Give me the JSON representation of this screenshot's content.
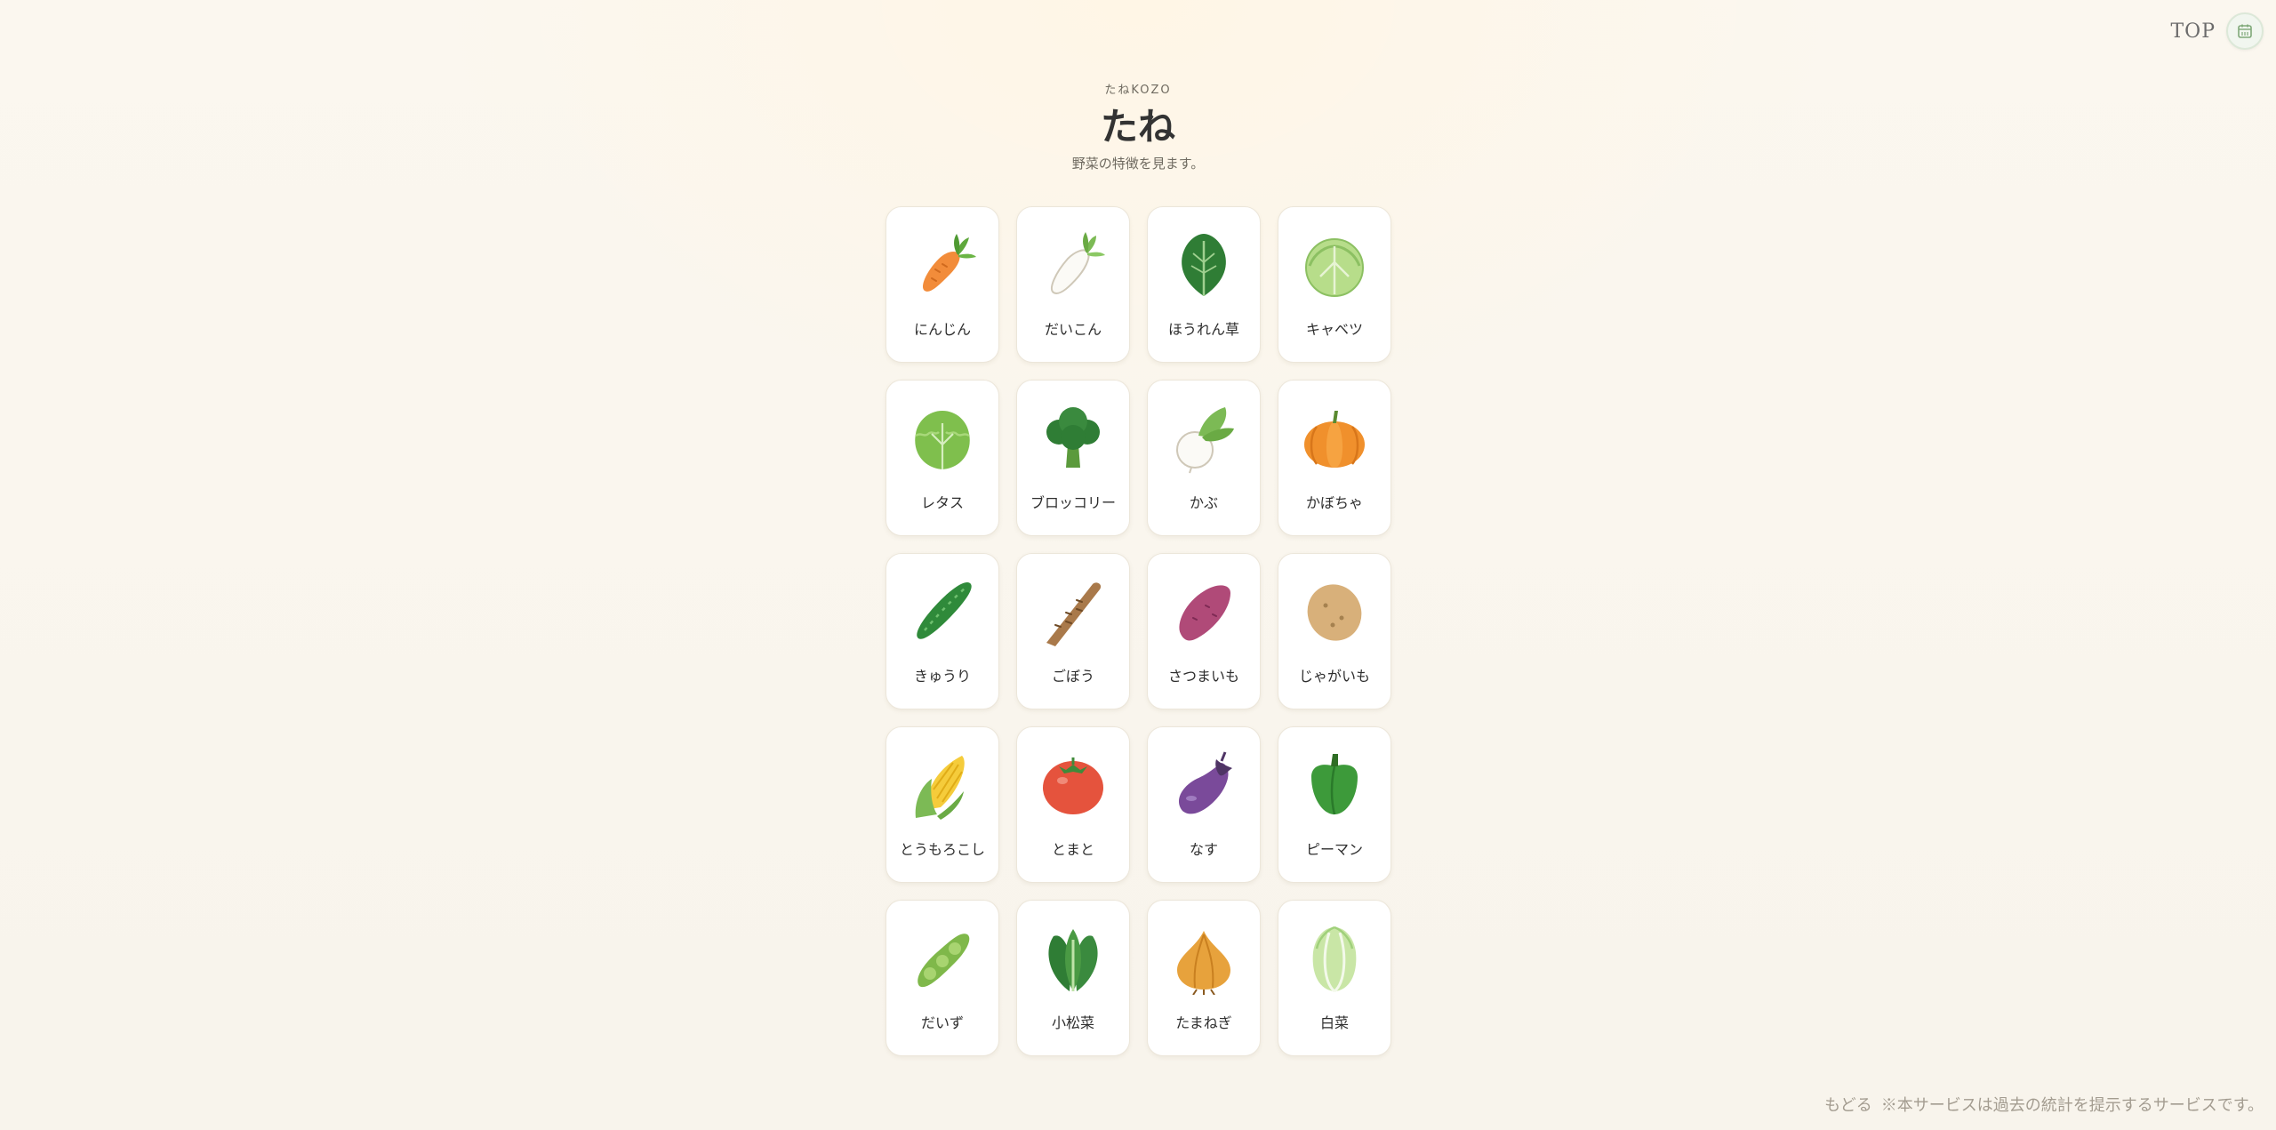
{
  "nav": {
    "top_label": "TOP",
    "icon": "calendar-icon"
  },
  "header": {
    "brand": "たねKOZO",
    "title": "たね",
    "subtitle": "野菜の特徴を見ます。"
  },
  "cards": [
    {
      "label": "にんじん",
      "icon": "carrot-icon"
    },
    {
      "label": "だいこん",
      "icon": "daikon-icon"
    },
    {
      "label": "ほうれん草",
      "icon": "spinach-icon"
    },
    {
      "label": "キャベツ",
      "icon": "cabbage-icon"
    },
    {
      "label": "レタス",
      "icon": "lettuce-icon"
    },
    {
      "label": "ブロッコリー",
      "icon": "broccoli-icon"
    },
    {
      "label": "かぶ",
      "icon": "turnip-icon"
    },
    {
      "label": "かぼちゃ",
      "icon": "pumpkin-icon"
    },
    {
      "label": "きゅうり",
      "icon": "cucumber-icon"
    },
    {
      "label": "ごぼう",
      "icon": "burdock-icon"
    },
    {
      "label": "さつまいも",
      "icon": "sweet-potato-icon"
    },
    {
      "label": "じゃがいも",
      "icon": "potato-icon"
    },
    {
      "label": "とうもろこし",
      "icon": "corn-icon"
    },
    {
      "label": "とまと",
      "icon": "tomato-icon"
    },
    {
      "label": "なす",
      "icon": "eggplant-icon"
    },
    {
      "label": "ピーマン",
      "icon": "green-pepper-icon"
    },
    {
      "label": "だいず",
      "icon": "soybean-icon"
    },
    {
      "label": "小松菜",
      "icon": "komatsuna-icon"
    },
    {
      "label": "たまねぎ",
      "icon": "onion-icon"
    },
    {
      "label": "白菜",
      "icon": "napa-cabbage-icon"
    }
  ],
  "footer": {
    "back_label": "もどる",
    "note": "※本サービスは過去の統計を提示するサービスです。"
  }
}
